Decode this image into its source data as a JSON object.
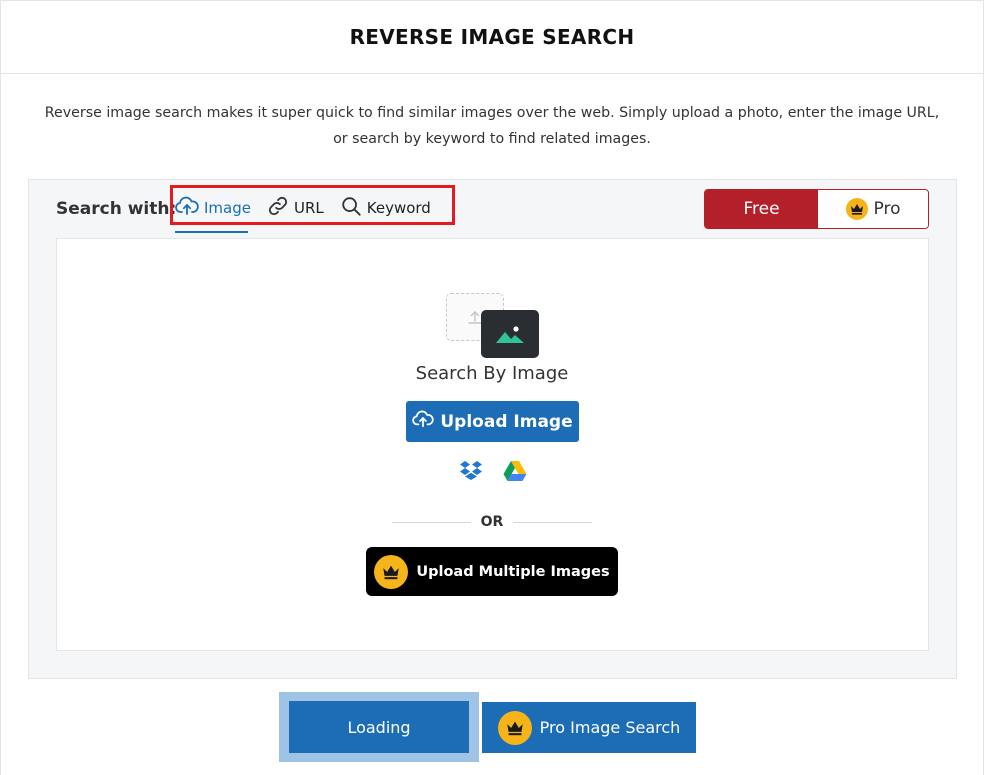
{
  "page": {
    "title": "REVERSE IMAGE SEARCH",
    "intro": "Reverse image search makes it super quick to find similar images over the web. Simply upload a photo, enter the image URL, or search by keyword to find related images."
  },
  "search": {
    "label": "Search with:",
    "tabs": [
      {
        "label": "Image",
        "icon": "cloud-upload-icon",
        "active": true
      },
      {
        "label": "URL",
        "icon": "link-icon",
        "active": false
      },
      {
        "label": "Keyword",
        "icon": "search-icon",
        "active": false
      }
    ]
  },
  "plans": {
    "free_label": "Free",
    "pro_label": "Pro"
  },
  "upload": {
    "heading": "Search By Image",
    "button_label": "Upload Image",
    "sources": [
      "dropbox-icon",
      "google-drive-icon"
    ],
    "or_label": "OR",
    "multi_label": "Upload Multiple Images"
  },
  "actions": {
    "loading_label": "Loading",
    "pro_search_label": "Pro Image Search"
  },
  "colors": {
    "primary": "#1d6db6",
    "free_red": "#b3202a",
    "highlight_red": "#e31a1f",
    "crown_gold": "#f5b41a",
    "loading_halo": "#9ec3e4"
  }
}
